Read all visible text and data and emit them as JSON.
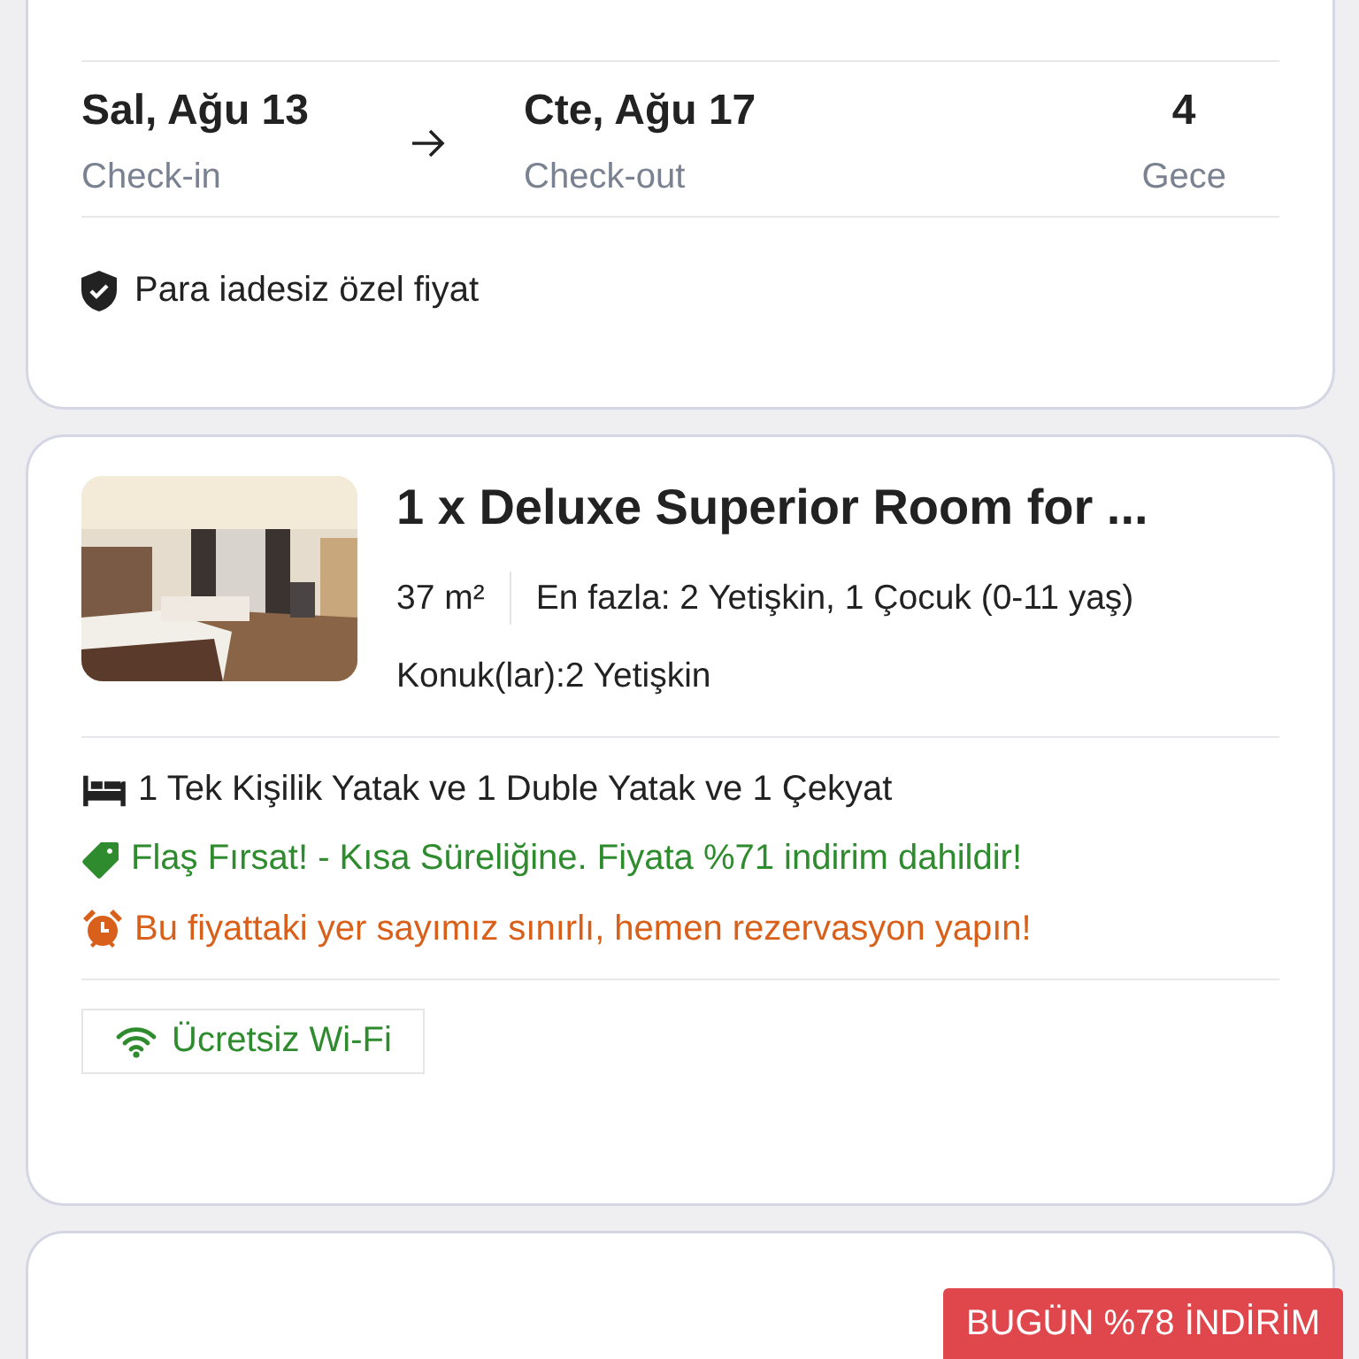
{
  "stay": {
    "checkin": {
      "date": "Sal, Ağu 13",
      "label": "Check-in"
    },
    "checkout": {
      "date": "Cte, Ağu 17",
      "label": "Check-out"
    },
    "nights": {
      "count": "4",
      "label": "Gece"
    },
    "policy": "Para iadesiz özel fiyat"
  },
  "room": {
    "title": "1 x Deluxe Superior Room for ...",
    "size": "37 m²",
    "capacity": "En fazla: 2 Yetişkin, 1 Çocuk (0-11 yaş)",
    "guests": "Konuk(lar):2 Yetişkin",
    "perks": [
      {
        "kind": "bed",
        "text": "1 Tek Kişilik Yatak ve 1 Duble Yatak ve 1 Çekyat"
      },
      {
        "kind": "deal",
        "text": "Flaş Fırsat! - Kısa Süreliğine. Fiyata %71 indirim dahildir!"
      },
      {
        "kind": "urgency",
        "text": "Bu fiyattaki yer sayımız sınırlı, hemen rezervasyon yapın!"
      }
    ],
    "amenities": [
      "Ücretsiz Wi-Fi"
    ]
  },
  "next_offer": {
    "badge": "BUGÜN %78 İNDİRİM"
  }
}
